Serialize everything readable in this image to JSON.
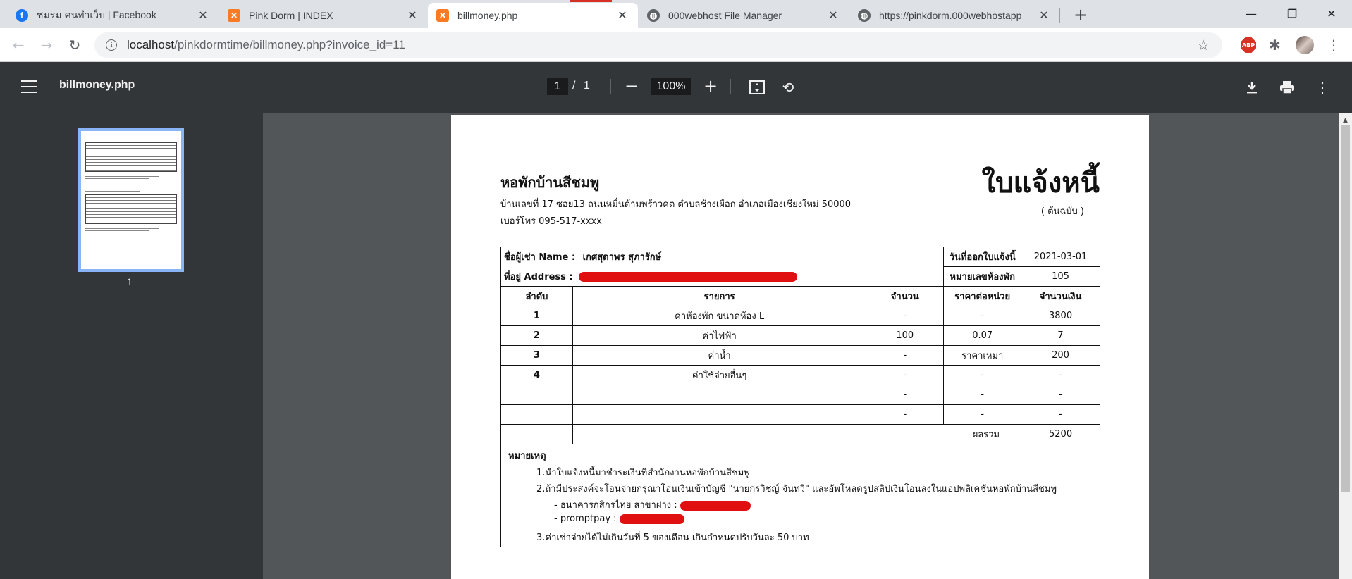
{
  "browser": {
    "tabs": [
      {
        "title": "ชมรม คนทำเว็บ | Facebook",
        "icon": "facebook-icon"
      },
      {
        "title": "Pink Dorm | INDEX",
        "icon": "xampp-icon"
      },
      {
        "title": "billmoney.php",
        "icon": "xampp-icon"
      },
      {
        "title": "000webhost File Manager",
        "icon": "globe-icon"
      },
      {
        "title": "https://pinkdorm.000webhostapp",
        "icon": "globe-icon"
      }
    ],
    "close_glyph": "✕",
    "new_tab_glyph": "+",
    "url_host": "localhost",
    "url_path": "/pinkdormtime/billmoney.php?invoice_id=11",
    "abp_label": "ABP"
  },
  "pdf": {
    "title": "billmoney.php",
    "current_page": "1",
    "page_separator": "/",
    "total_pages": "1",
    "zoom": "100%",
    "thumbnail_label": "1"
  },
  "invoice": {
    "dorm_name": "หอพักบ้านสีชมพู",
    "address": "บ้านเลขที่ 17 ซอย13 ถนนหมื่นด้ามพร้าวคต ตำบลช้างเผือก อำเภอเมืองเชียงใหม่ 50000",
    "phone": "เบอร์โทร 095-517-xxxx",
    "doc_title": "ใบแจ้งหนี้",
    "doc_subtitle": "( ต้นฉบับ )",
    "tenant_label": "ชื่อผู้เช่า Name :",
    "tenant_name": "เกศสุดาพร สุภารักษ์",
    "address_label": "ที่อยู่ Address :",
    "issue_date_label": "วันที่ออกใบแจ้งนี้",
    "issue_date": "2021-03-01",
    "room_label": "หมายเลขห้องพัก",
    "room_no": "105",
    "columns": [
      "ลำดับ",
      "รายการ",
      "จำนวน",
      "ราคาต่อหน่วย",
      "จำนวนเงิน"
    ],
    "rows": [
      {
        "no": "1",
        "item": "ค่าห้องพัก ขนาดห้อง L",
        "qty": "-",
        "unit_price": "-",
        "amount": "3800"
      },
      {
        "no": "2",
        "item": "ค่าไฟฟ้า",
        "qty": "100",
        "unit_price": "0.07",
        "amount": "7"
      },
      {
        "no": "3",
        "item": "ค่าน้ำ",
        "qty": "-",
        "unit_price": "ราคาเหมา",
        "amount": "200"
      },
      {
        "no": "4",
        "item": "ค่าใช้จ่ายอื่นๆ",
        "qty": "-",
        "unit_price": "-",
        "amount": "-"
      },
      {
        "no": "",
        "item": "",
        "qty": "-",
        "unit_price": "-",
        "amount": "-"
      },
      {
        "no": "",
        "item": "",
        "qty": "-",
        "unit_price": "-",
        "amount": "-"
      }
    ],
    "total_label": "ผลรวม",
    "total": "5200",
    "notes_title": "หมายเหตุ",
    "notes": [
      "1.นำใบแจ้งหนี้มาชำระเงินที่สำนักงานหอพักบ้านสีชมพู",
      "2.ถ้ามีประสงค์จะโอนจ่ายกรุณาโอนเงินเข้าบัญชี \"นายกรวิชญ์ จันทวี\" และอัพโหลดรูปสลิปเงินโอนลงในแอปพลิเคชันหอพักบ้านสีชมพู",
      "- ธนาคารกสิกรไทย สาขาฝาง :",
      "- promptpay :",
      "3.ค่าเช่าจ่ายได้ไม่เกินวันที่ 5 ของเดือน เกินกำหนดปรับวันละ 50 บาท"
    ]
  }
}
